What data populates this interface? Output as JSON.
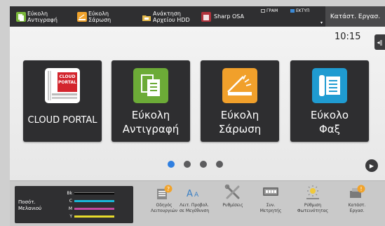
{
  "topbar": {
    "shortcuts": [
      {
        "label": "Εύκολη\nΑντιγραφή",
        "icon": "easy-copy-icon"
      },
      {
        "label": "Εύκολη\nΣάρωση",
        "icon": "easy-scan-icon"
      },
      {
        "label": "Ανάκτηση\nΑρχείου HDD",
        "icon": "hdd-retrieve-icon"
      },
      {
        "label": "Sharp OSA",
        "icon": "sharp-osa-icon"
      }
    ],
    "status_print": "ΓΡΑΜ",
    "status_scan": "ΕΚΤΥΠ",
    "job_status_button": "Κατάστ. Εργασ."
  },
  "clock": "10:15",
  "tiles": [
    {
      "label": "CLOUD PORTAL",
      "icon": "cloud-portal-icon",
      "art_text": "CLOUD\nPORTAL"
    },
    {
      "label": "Εύκολη\nΑντιγραφή",
      "icon": "easy-copy-icon"
    },
    {
      "label": "Εύκολη\nΣάρωση",
      "icon": "easy-scan-icon"
    },
    {
      "label": "Εύκολο\nΦαξ",
      "icon": "easy-fax-icon"
    }
  ],
  "page_dots": {
    "count": 4,
    "active": 0
  },
  "toner": {
    "label": "Ποσότ.\nΜελανιού",
    "rows": [
      {
        "code": "Bk",
        "color": "#000000"
      },
      {
        "code": "C",
        "color": "#19b6d8"
      },
      {
        "code": "M",
        "color": "#c34aa0"
      },
      {
        "code": "Y",
        "color": "#e7da2c"
      }
    ]
  },
  "bottom_items": [
    {
      "label": "Οδηγός\nΛειτουργιών",
      "icon": "operation-guide-icon"
    },
    {
      "label": "Λειτ. Προβολ.\nσε Μεγέθυνση",
      "icon": "enlarge-display-icon"
    },
    {
      "label": "Ρυθμίσεις",
      "icon": "settings-icon"
    },
    {
      "label": "Συν.\nΜετρητής",
      "icon": "total-count-icon"
    },
    {
      "label": "Ρύθμιση\nΦωτεινότητας",
      "icon": "brightness-icon"
    },
    {
      "label": "Κατάστ.\nΕργασ.",
      "icon": "job-status-icon"
    }
  ]
}
